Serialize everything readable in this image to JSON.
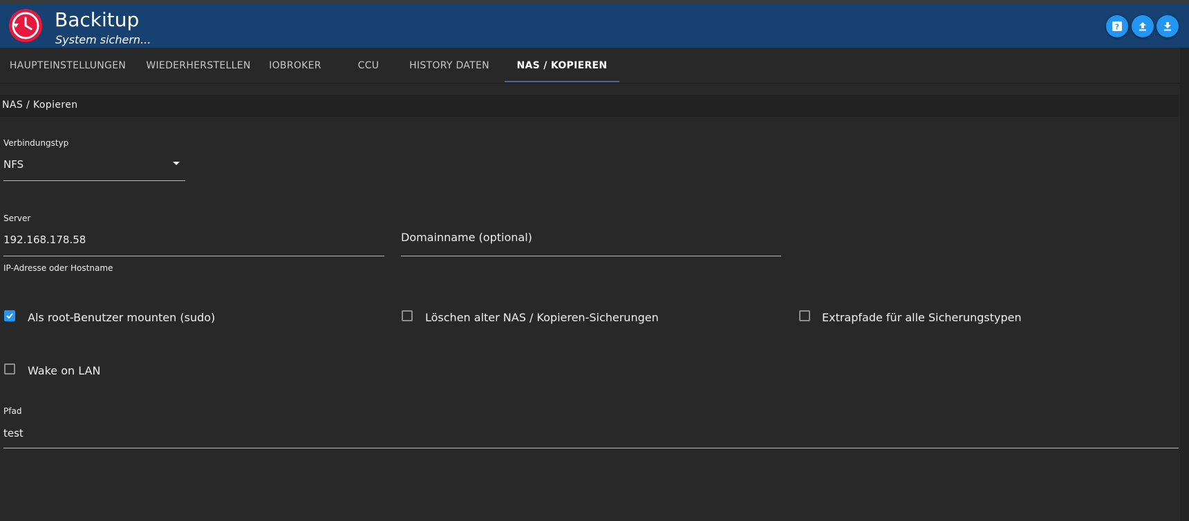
{
  "app": {
    "title": "Backitup",
    "subtitle": "System sichern..."
  },
  "header_buttons": [
    {
      "icon": "help-icon"
    },
    {
      "icon": "upload-icon"
    },
    {
      "icon": "download-icon"
    }
  ],
  "tabs": [
    {
      "label": "HAUPTEINSTELLUNGEN",
      "active": false
    },
    {
      "label": "WIEDERHERSTELLEN",
      "active": false
    },
    {
      "label": "IOBROKER",
      "active": false
    },
    {
      "label": "CCU",
      "active": false
    },
    {
      "label": "HISTORY DATEN",
      "active": false
    },
    {
      "label": "NAS / KOPIEREN",
      "active": true
    }
  ],
  "section": {
    "title": "NAS / Kopieren"
  },
  "connection_type": {
    "label": "Verbindungstyp",
    "value": "NFS"
  },
  "server": {
    "label": "Server",
    "value": "192.168.178.58",
    "helper": "IP-Adresse oder Hostname"
  },
  "domain": {
    "placeholder": "Domainname (optional)"
  },
  "checkboxes": [
    {
      "label": "Als root-Benutzer mounten (sudo)",
      "checked": true
    },
    {
      "label": "Löschen alter NAS / Kopieren-Sicherungen",
      "checked": false
    },
    {
      "label": "Extrapfade für alle Sicherungstypen",
      "checked": false
    },
    {
      "label": "Wake on LAN",
      "checked": false
    }
  ],
  "path": {
    "label": "Pfad",
    "value": "test"
  },
  "colors": {
    "header_bg": "#174170",
    "accent": "#2196f3",
    "logo_red": "#e8183c",
    "background": "#282828"
  }
}
